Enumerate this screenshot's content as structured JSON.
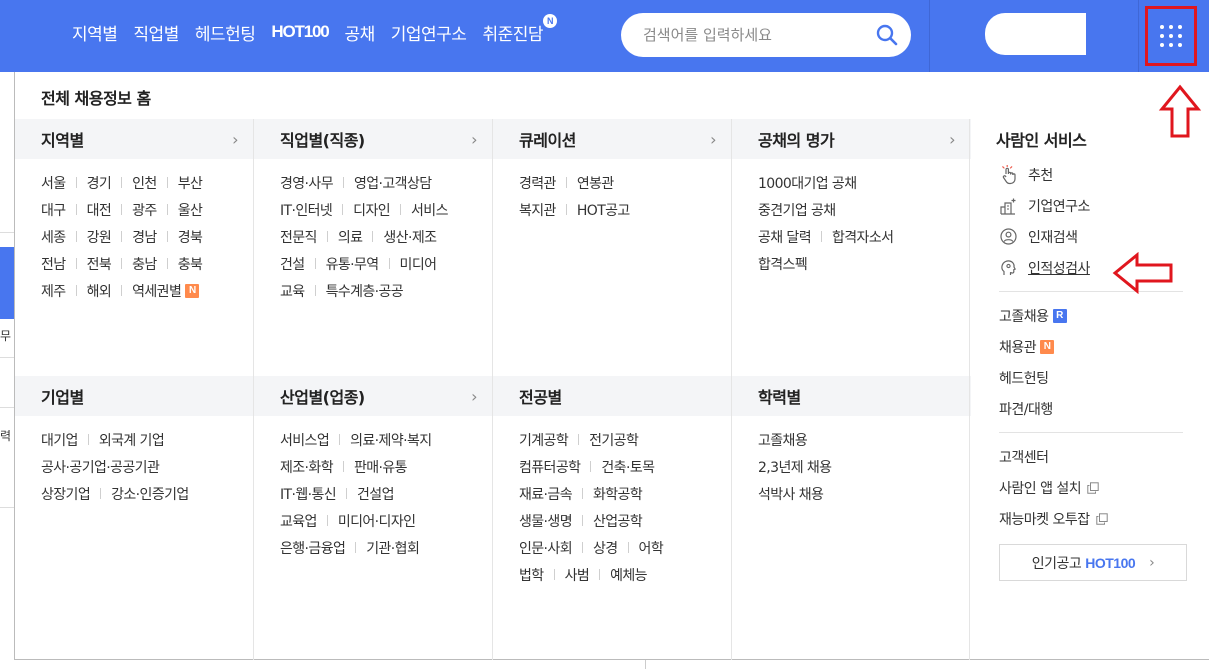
{
  "header": {
    "nav": [
      {
        "label": "지역별"
      },
      {
        "label": "직업별"
      },
      {
        "label": "헤드헌팅"
      },
      {
        "label": "HOT100"
      },
      {
        "label": "공채"
      },
      {
        "label": "기업연구소"
      },
      {
        "label": "취준진담",
        "badge": "N"
      }
    ],
    "search_placeholder": "검색어를 입력하세요",
    "brand_color": "#4876ef"
  },
  "panel": {
    "title": "전체 채용정보 홈",
    "columns_top": [
      {
        "title": "지역별",
        "chevron": "›",
        "rows": [
          [
            {
              "t": "서울"
            },
            {
              "t": "경기"
            },
            {
              "t": "인천"
            },
            {
              "t": "부산"
            }
          ],
          [
            {
              "t": "대구"
            },
            {
              "t": "대전"
            },
            {
              "t": "광주"
            },
            {
              "t": "울산"
            }
          ],
          [
            {
              "t": "세종"
            },
            {
              "t": "강원"
            },
            {
              "t": "경남"
            },
            {
              "t": "경북"
            }
          ],
          [
            {
              "t": "전남"
            },
            {
              "t": "전북"
            },
            {
              "t": "충남"
            },
            {
              "t": "충북"
            }
          ],
          [
            {
              "t": "제주"
            },
            {
              "t": "해외"
            },
            {
              "t": "역세권별",
              "badge": "N"
            }
          ]
        ]
      },
      {
        "title": "직업별(직종)",
        "chevron": "›",
        "rows": [
          [
            {
              "t": "경영·사무"
            },
            {
              "t": "영업·고객상담"
            }
          ],
          [
            {
              "t": "IT·인터넷"
            },
            {
              "t": "디자인"
            },
            {
              "t": "서비스"
            }
          ],
          [
            {
              "t": "전문직"
            },
            {
              "t": "의료"
            },
            {
              "t": "생산·제조"
            }
          ],
          [
            {
              "t": "건설"
            },
            {
              "t": "유통·무역"
            },
            {
              "t": "미디어"
            }
          ],
          [
            {
              "t": "교육"
            },
            {
              "t": "특수계층·공공"
            }
          ]
        ]
      },
      {
        "title": "큐레이션",
        "chevron": "›",
        "rows": [
          [
            {
              "t": "경력관"
            },
            {
              "t": "연봉관"
            }
          ],
          [
            {
              "t": "복지관"
            },
            {
              "t": "HOT공고"
            }
          ]
        ]
      },
      {
        "title": "공채의 명가",
        "chevron": "›",
        "rows": [
          [
            {
              "t": "1000대기업 공채"
            }
          ],
          [
            {
              "t": "중견기업 공채"
            }
          ],
          [
            {
              "t": "공채 달력"
            },
            {
              "t": "합격자소서"
            }
          ],
          [
            {
              "t": "합격스펙"
            }
          ]
        ]
      }
    ],
    "columns_bottom": [
      {
        "title": "기업별",
        "chevron": "",
        "rows": [
          [
            {
              "t": "대기업"
            },
            {
              "t": "외국계 기업"
            }
          ],
          [
            {
              "t": "공사·공기업·공공기관"
            }
          ],
          [
            {
              "t": "상장기업"
            },
            {
              "t": "강소·인증기업"
            }
          ]
        ]
      },
      {
        "title": "산업별(업종)",
        "chevron": "›",
        "rows": [
          [
            {
              "t": "서비스업"
            },
            {
              "t": "의료·제약·복지"
            }
          ],
          [
            {
              "t": "제조·화학"
            },
            {
              "t": "판매·유통"
            }
          ],
          [
            {
              "t": "IT·웹·통신"
            },
            {
              "t": "건설업"
            }
          ],
          [
            {
              "t": "교육업"
            },
            {
              "t": "미디어·디자인"
            }
          ],
          [
            {
              "t": "은행·금융업"
            },
            {
              "t": "기관·협회"
            }
          ]
        ]
      },
      {
        "title": "전공별",
        "chevron": "",
        "rows": [
          [
            {
              "t": "기계공학"
            },
            {
              "t": "전기공학"
            }
          ],
          [
            {
              "t": "컴퓨터공학"
            },
            {
              "t": "건축·토목"
            }
          ],
          [
            {
              "t": "재료·금속"
            },
            {
              "t": "화학공학"
            }
          ],
          [
            {
              "t": "생물·생명"
            },
            {
              "t": "산업공학"
            }
          ],
          [
            {
              "t": "인문·사회"
            },
            {
              "t": "상경"
            },
            {
              "t": "어학"
            }
          ],
          [
            {
              "t": "법학"
            },
            {
              "t": "사범"
            },
            {
              "t": "예체능"
            }
          ]
        ]
      },
      {
        "title": "학력별",
        "chevron": "",
        "rows": [
          [
            {
              "t": "고졸채용"
            }
          ],
          [
            {
              "t": "2,3년제 채용"
            }
          ],
          [
            {
              "t": "석박사 채용"
            }
          ]
        ]
      }
    ],
    "services": {
      "title": "사람인 서비스",
      "items": [
        {
          "label": "추천",
          "icon": "hand-pointer-icon"
        },
        {
          "label": "기업연구소",
          "icon": "building-icon"
        },
        {
          "label": "인재검색",
          "icon": "person-search-icon"
        },
        {
          "label": "인적성검사",
          "icon": "head-gear-icon"
        }
      ],
      "links_1": [
        {
          "label": "고졸채용",
          "badge": "R"
        },
        {
          "label": "채용관",
          "badge": "N"
        },
        {
          "label": "헤드헌팅"
        },
        {
          "label": "파견/대행"
        }
      ],
      "links_2": [
        {
          "label": "고객센터"
        },
        {
          "label": "사람인 앱 설치",
          "ext": true
        },
        {
          "label": "재능마켓 오투잡",
          "ext": true
        }
      ],
      "hot_button": {
        "prefix": "인기공고",
        "hot": "HOT100",
        "chevron": "›"
      }
    }
  },
  "behind": {
    "left_text_1": "무",
    "left_text_2": "력"
  },
  "annotation_color": "#e0161e"
}
